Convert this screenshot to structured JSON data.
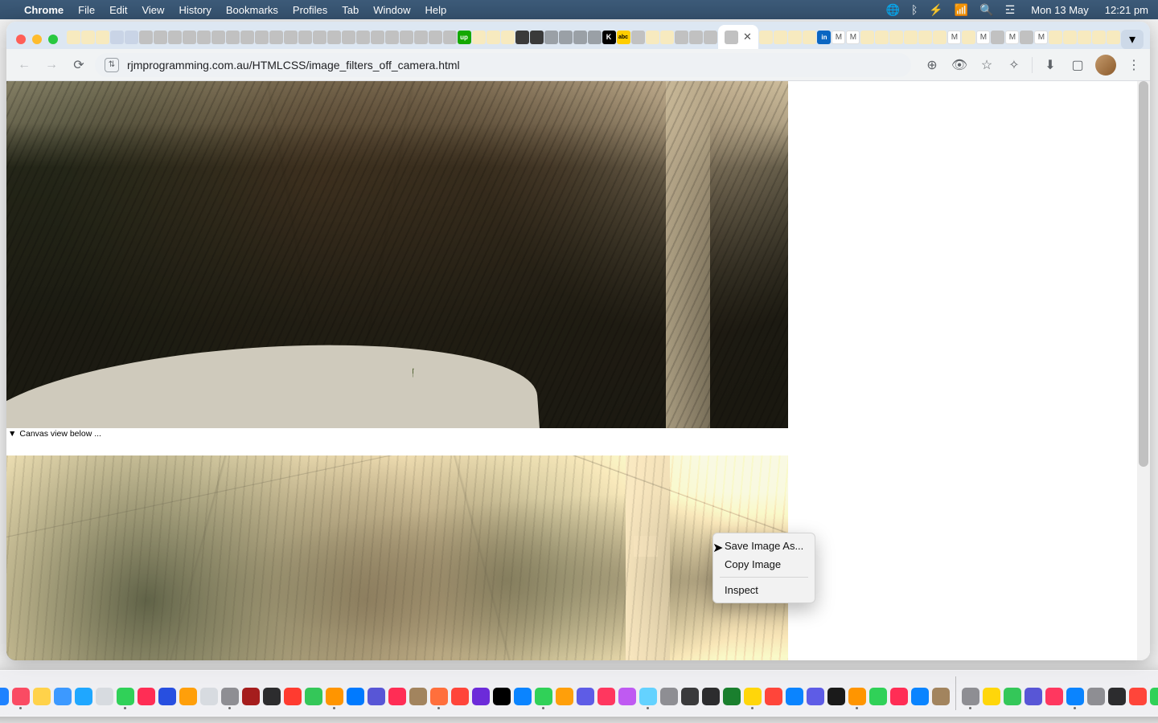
{
  "menubar": {
    "app": "Chrome",
    "items": [
      "File",
      "Edit",
      "View",
      "History",
      "Bookmarks",
      "Profiles",
      "Tab",
      "Window",
      "Help"
    ],
    "status": {
      "globe": "🌐",
      "bt": "BT",
      "battery": "🔋",
      "wifi": "📶",
      "search": "🔍",
      "cc": "☰"
    },
    "date": "Mon 13 May",
    "time": "12:21 pm"
  },
  "chrome": {
    "toolbar": {
      "back_hint": "Back",
      "fwd_hint": "Forward",
      "reload_hint": "Reload",
      "site_chip_hint": "View site information"
    },
    "omnibox": {
      "url": "rjmprogramming.com.au/HTMLCSS/image_filters_off_camera.html"
    },
    "actions": {
      "zoom": "Zoom",
      "eye": "Reader",
      "star": "Bookmark this tab",
      "ext": "Extensions",
      "dl": "Downloads",
      "panel": "Side panel",
      "profile": "Profile",
      "menu": "Customize and control Google Chrome"
    },
    "newtab_hint": "New tab",
    "tab_overflow_hint": "Search tabs"
  },
  "page": {
    "caption_marker": "▼",
    "caption_text": " Canvas view below ..."
  },
  "context_menu": {
    "save": "Save Image As...",
    "copy": "Copy Image",
    "inspect": "Inspect"
  },
  "icons": {
    "apple": "",
    "back": "←",
    "fwd": "→",
    "reload": "⟳",
    "zoom": "⊕",
    "eye": "👁",
    "star": "☆",
    "ext": "✧",
    "dl": "⬇",
    "panel": "▢",
    "kebab": "⋮",
    "plus": "＋",
    "chev": "▾",
    "close": "✕",
    "globe": "🌐",
    "bt": "ᛒ",
    "battery": "⚡",
    "wifi": "📶",
    "search": "🔍",
    "cc": "☲"
  },
  "dock_colors": [
    "#1e82ff",
    "#fa4b63",
    "#ffd24a",
    "#3c99ff",
    "#1fa7ff",
    "#d7dbe0",
    "#30d158",
    "#ff2d55",
    "#274fe0",
    "#ff9f0a",
    "#d7dbe0",
    "#8e8e93",
    "#a51d1d",
    "#2c2c2e",
    "#ff3b30",
    "#34c759",
    "#ff9500",
    "#007aff",
    "#5856d6",
    "#ff2d55",
    "#a2845e",
    "#ff6f3c",
    "#ff453a",
    "#6c2bd9",
    "#000000",
    "#0a84ff",
    "#30d158",
    "#ff9f0a",
    "#5e5ce6",
    "#ff375f",
    "#bf5af2",
    "#64d2ff",
    "#8e8e93",
    "#3a3a3c",
    "#2c2c2e",
    "#1a7f2e",
    "#ffd60a",
    "#ff453a",
    "#0a84ff",
    "#5e5ce6",
    "#1a1a1a",
    "#ff9500",
    "#30d158",
    "#ff2d55",
    "#0a84ff",
    "#a2845e",
    "#8e8e93",
    "#ffd60a",
    "#34c759",
    "#5856d6",
    "#ff375f",
    "#0a84ff",
    "#8e8e93",
    "#2c2c2e",
    "#ff453a",
    "#30d158"
  ]
}
